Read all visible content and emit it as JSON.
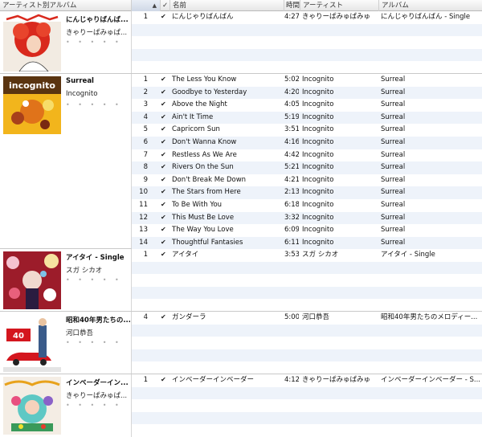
{
  "header": {
    "album_by_artist": "アーティスト別アルバム",
    "check": "✓",
    "name": "名前",
    "time": "時間",
    "artist": "アーティスト",
    "album": "アルバム",
    "sort_indicator": "▲"
  },
  "rating_placeholder": "• • • • •",
  "groups": [
    {
      "title": "にんじゃりばんば...",
      "artist": "きゃりーぱみゅぱ...",
      "tracks": [
        {
          "num": "1",
          "name": "にんじゃりばんばん",
          "time": "4:27",
          "artist": "きゃりーぱみゅぱみゅ",
          "album": "にんじゃりばんばん - Single"
        }
      ]
    },
    {
      "title": "Surreal",
      "artist": "Incognito",
      "tracks": [
        {
          "num": "1",
          "name": "The Less You Know",
          "time": "5:02",
          "artist": "Incognito",
          "album": "Surreal"
        },
        {
          "num": "2",
          "name": "Goodbye to Yesterday",
          "time": "4:20",
          "artist": "Incognito",
          "album": "Surreal"
        },
        {
          "num": "3",
          "name": "Above the Night",
          "time": "4:05",
          "artist": "Incognito",
          "album": "Surreal"
        },
        {
          "num": "4",
          "name": "Ain't It Time",
          "time": "5:19",
          "artist": "Incognito",
          "album": "Surreal"
        },
        {
          "num": "5",
          "name": "Capricorn Sun",
          "time": "3:51",
          "artist": "Incognito",
          "album": "Surreal"
        },
        {
          "num": "6",
          "name": "Don't Wanna Know",
          "time": "4:16",
          "artist": "Incognito",
          "album": "Surreal"
        },
        {
          "num": "7",
          "name": "Restless As We Are",
          "time": "4:42",
          "artist": "Incognito",
          "album": "Surreal"
        },
        {
          "num": "8",
          "name": "Rivers On the Sun",
          "time": "5:21",
          "artist": "Incognito",
          "album": "Surreal"
        },
        {
          "num": "9",
          "name": "Don't Break Me Down",
          "time": "4:21",
          "artist": "Incognito",
          "album": "Surreal"
        },
        {
          "num": "10",
          "name": "The Stars from Here",
          "time": "2:13",
          "artist": "Incognito",
          "album": "Surreal"
        },
        {
          "num": "11",
          "name": "To Be With You",
          "time": "6:18",
          "artist": "Incognito",
          "album": "Surreal"
        },
        {
          "num": "12",
          "name": "This Must Be Love",
          "time": "3:32",
          "artist": "Incognito",
          "album": "Surreal"
        },
        {
          "num": "13",
          "name": "The Way You Love",
          "time": "6:09",
          "artist": "Incognito",
          "album": "Surreal"
        },
        {
          "num": "14",
          "name": "Thoughtful Fantasies",
          "time": "6:11",
          "artist": "Incognito",
          "album": "Surreal"
        }
      ]
    },
    {
      "title": "アイタイ - Single",
      "artist": "スガ シカオ",
      "tracks": [
        {
          "num": "1",
          "name": "アイタイ",
          "time": "3:53",
          "artist": "スガ シカオ",
          "album": "アイタイ - Single"
        }
      ]
    },
    {
      "title": "昭和40年男たちの...",
      "artist": "河口恭吾",
      "tracks": [
        {
          "num": "4",
          "name": "ガンダーラ",
          "time": "5:00",
          "artist": "河口恭吾",
          "album": "昭和40年男たちのメロディー..."
        }
      ]
    },
    {
      "title": "インベーダーイン...",
      "artist": "きゃりーぱみゅぱ...",
      "tracks": [
        {
          "num": "1",
          "name": "インベーダーインベーダー",
          "time": "4:12",
          "artist": "きゃりーぱみゅぱみゅ",
          "album": "インベーダーインベーダー - S..."
        }
      ]
    }
  ]
}
